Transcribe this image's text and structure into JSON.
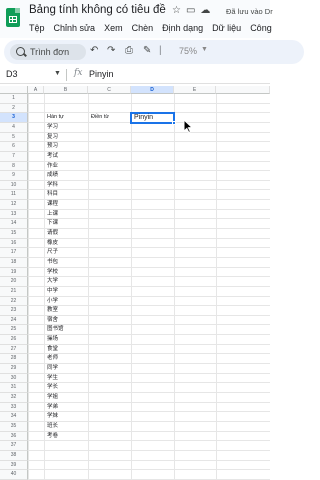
{
  "app": {
    "doc_title": "Bảng tính không có tiêu đề",
    "saved_status": "Đã lưu vào Dr",
    "menus": [
      "Tệp",
      "Chỉnh sửa",
      "Xem",
      "Chèn",
      "Định dạng",
      "Dữ liệu",
      "Công"
    ]
  },
  "toolbar": {
    "search_label": "Trình đơn",
    "zoom": "75%"
  },
  "formula_bar": {
    "cell_ref": "D3",
    "fx": "fx",
    "value": "Pinyin"
  },
  "sheet": {
    "columns": [
      "A",
      "B",
      "C",
      "D",
      "E"
    ],
    "active_column": "D",
    "active_row": 3,
    "rows": [
      "1",
      "2",
      "3",
      "4",
      "5",
      "6",
      "7",
      "8",
      "9",
      "10",
      "11",
      "12",
      "13",
      "14",
      "15",
      "16",
      "17",
      "18",
      "19",
      "20",
      "21",
      "22",
      "23",
      "24",
      "25",
      "26",
      "27",
      "28",
      "29",
      "30",
      "31",
      "32",
      "33",
      "34",
      "35",
      "36",
      "37",
      "38",
      "39",
      "40"
    ],
    "header_b": "Hán tự",
    "header_c": "Điền từ",
    "header_d": "Pinyin",
    "column_b_values": [
      "学习",
      "复习",
      "预习",
      "考试",
      "作业",
      "成绩",
      "学科",
      "科目",
      "课程",
      "上课",
      "下课",
      "请假",
      "橡皮",
      "尺子",
      "书包",
      "学校",
      "大学",
      "中学",
      "小学",
      "教室",
      "宿舍",
      "图书馆",
      "操场",
      "食堂",
      "老师",
      "同学",
      "学生",
      "学长",
      "学姐",
      "学弟",
      "学妹",
      "班长",
      "考卷"
    ]
  },
  "colors": {
    "accent": "#1a73e8",
    "sheets_green": "#0f9d58",
    "header_bg": "#f8f9fa",
    "active_header_bg": "#d3e3fd"
  }
}
